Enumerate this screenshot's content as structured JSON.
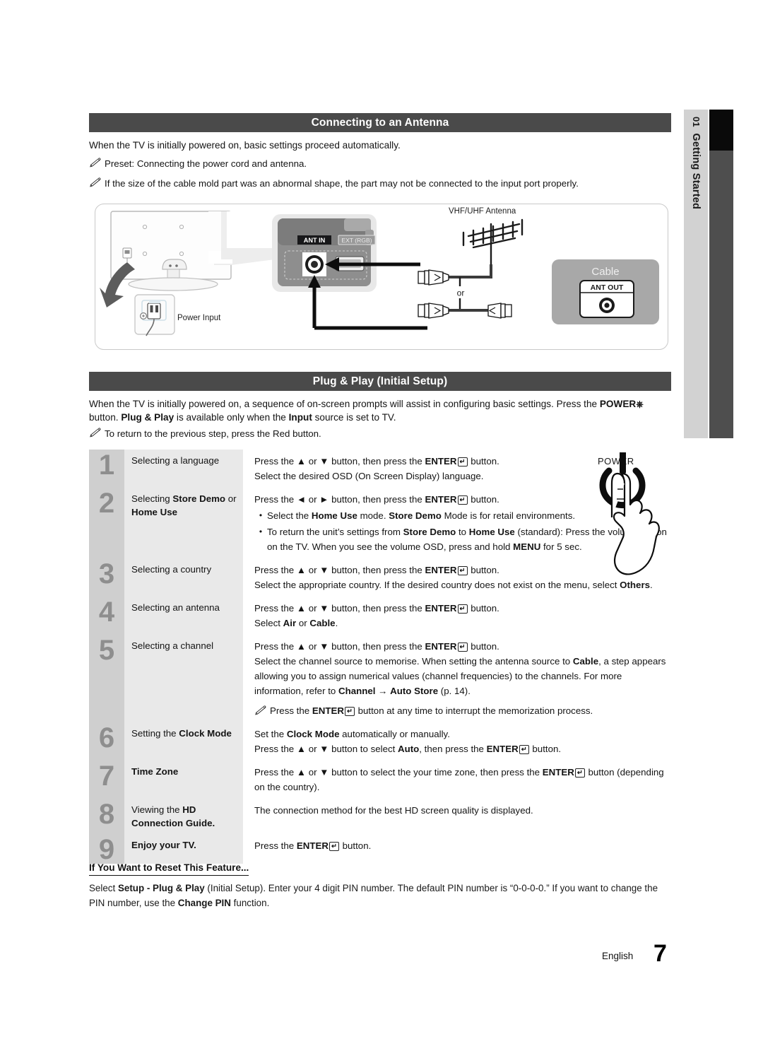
{
  "sidebar": {
    "chapter_number": "01",
    "chapter_title": "Getting Started"
  },
  "sections": {
    "antenna": {
      "title": "Connecting to an Antenna",
      "intro": "When the TV is initially powered on, basic settings proceed automatically.",
      "note1": "Preset: Connecting the power cord and antenna.",
      "note2": "If the size of the cable mold part was an abnormal shape, the part may not be connected to the input port properly."
    },
    "plugplay": {
      "title": "Plug & Play (Initial Setup)",
      "intro_1": "When the TV is initially powered on, a sequence of on-screen prompts will assist in configuring basic settings. Press the ",
      "intro_power": "POWER",
      "intro_2": " button. ",
      "intro_pp": "Plug & Play",
      "intro_3": " is available only when the ",
      "intro_input": "Input",
      "intro_4": " source is set to TV.",
      "note1": "To return to the previous step, press the Red button."
    }
  },
  "diagram": {
    "power_input_label": "Power Input",
    "ant_in_label": "ANT IN",
    "ext_rgb_label": "EXT (RGB)",
    "antenna_label": "VHF/UHF Antenna",
    "or_label": "or",
    "cable_label": "Cable",
    "ant_out_label": "ANT OUT"
  },
  "power_illustration": {
    "label": "POWER"
  },
  "steps": [
    {
      "number": "1",
      "label_parts": [
        {
          "t": "Selecting a language",
          "b": false
        }
      ],
      "lines": [
        {
          "type": "text",
          "parts": [
            {
              "t": "Press the ",
              "b": false
            },
            {
              "t": "▲",
              "b": false
            },
            {
              "t": " or ",
              "b": false
            },
            {
              "t": "▼",
              "b": false
            },
            {
              "t": " button, then press the ",
              "b": false
            },
            {
              "t": "ENTER",
              "b": true
            },
            {
              "t": "key",
              "b": false
            },
            {
              "t": " button.",
              "b": false
            }
          ]
        },
        {
          "type": "text",
          "parts": [
            {
              "t": "Select the desired OSD (On Screen Display) language.",
              "b": false
            }
          ]
        }
      ]
    },
    {
      "number": "2",
      "label_parts": [
        {
          "t": "Selecting ",
          "b": false
        },
        {
          "t": "Store Demo",
          "b": true
        },
        {
          "t": " or ",
          "b": false
        },
        {
          "t": "Home Use",
          "b": true
        }
      ],
      "lines": [
        {
          "type": "text",
          "parts": [
            {
              "t": "Press the ",
              "b": false
            },
            {
              "t": "◄",
              "b": false
            },
            {
              "t": " or ",
              "b": false
            },
            {
              "t": "►",
              "b": false
            },
            {
              "t": " button, then press the ",
              "b": false
            },
            {
              "t": "ENTER",
              "b": true
            },
            {
              "t": "key",
              "b": false
            },
            {
              "t": " button.",
              "b": false
            }
          ]
        },
        {
          "type": "bullet",
          "parts": [
            {
              "t": "Select the ",
              "b": false
            },
            {
              "t": "Home Use",
              "b": true
            },
            {
              "t": " mode. ",
              "b": false
            },
            {
              "t": "Store Demo",
              "b": true
            },
            {
              "t": " Mode is for retail environments.",
              "b": false
            }
          ]
        },
        {
          "type": "bullet",
          "parts": [
            {
              "t": "To return the unit’s settings from ",
              "b": false
            },
            {
              "t": "Store Demo",
              "b": true
            },
            {
              "t": " to ",
              "b": false
            },
            {
              "t": "Home Use",
              "b": true
            },
            {
              "t": " (standard): Press the volume button on the TV. When you see the volume OSD, press and hold ",
              "b": false
            },
            {
              "t": "MENU",
              "b": true
            },
            {
              "t": " for 5 sec.",
              "b": false
            }
          ]
        }
      ]
    },
    {
      "number": "3",
      "label_parts": [
        {
          "t": "Selecting a country",
          "b": false
        }
      ],
      "lines": [
        {
          "type": "text",
          "parts": [
            {
              "t": "Press the ",
              "b": false
            },
            {
              "t": "▲",
              "b": false
            },
            {
              "t": " or ",
              "b": false
            },
            {
              "t": "▼",
              "b": false
            },
            {
              "t": " button, then press the ",
              "b": false
            },
            {
              "t": "ENTER",
              "b": true
            },
            {
              "t": "key",
              "b": false
            },
            {
              "t": " button.",
              "b": false
            }
          ]
        },
        {
          "type": "text",
          "parts": [
            {
              "t": "Select the appropriate country. If the desired country does not exist on the menu, select ",
              "b": false
            },
            {
              "t": "Others",
              "b": true
            },
            {
              "t": ".",
              "b": false
            }
          ]
        }
      ]
    },
    {
      "number": "4",
      "label_parts": [
        {
          "t": "Selecting an antenna",
          "b": false
        }
      ],
      "lines": [
        {
          "type": "text",
          "parts": [
            {
              "t": "Press the ",
              "b": false
            },
            {
              "t": "▲",
              "b": false
            },
            {
              "t": " or ",
              "b": false
            },
            {
              "t": "▼",
              "b": false
            },
            {
              "t": " button, then press the ",
              "b": false
            },
            {
              "t": "ENTER",
              "b": true
            },
            {
              "t": "key",
              "b": false
            },
            {
              "t": " button.",
              "b": false
            }
          ]
        },
        {
          "type": "text",
          "parts": [
            {
              "t": "Select ",
              "b": false
            },
            {
              "t": "Air",
              "b": true
            },
            {
              "t": " or ",
              "b": false
            },
            {
              "t": "Cable",
              "b": true
            },
            {
              "t": ".",
              "b": false
            }
          ]
        }
      ]
    },
    {
      "number": "5",
      "label_parts": [
        {
          "t": "Selecting a channel",
          "b": false
        }
      ],
      "lines": [
        {
          "type": "text",
          "parts": [
            {
              "t": "Press the ",
              "b": false
            },
            {
              "t": "▲",
              "b": false
            },
            {
              "t": " or ",
              "b": false
            },
            {
              "t": "▼",
              "b": false
            },
            {
              "t": " button, then press the ",
              "b": false
            },
            {
              "t": "ENTER",
              "b": true
            },
            {
              "t": "key",
              "b": false
            },
            {
              "t": " button.",
              "b": false
            }
          ]
        },
        {
          "type": "text",
          "parts": [
            {
              "t": "Select the channel source to memorise. When setting the antenna source to ",
              "b": false
            },
            {
              "t": "Cable",
              "b": true
            },
            {
              "t": ", a step appears allowing you to assign numerical values (channel frequencies) to the channels. For more information, refer to ",
              "b": false
            },
            {
              "t": "Channel",
              "b": true
            },
            {
              "t": " → ",
              "b": false
            },
            {
              "t": "Auto Store",
              "b": true
            },
            {
              "t": " (p. 14).",
              "b": false
            }
          ]
        },
        {
          "type": "note",
          "parts": [
            {
              "t": "Press the ",
              "b": false
            },
            {
              "t": "ENTER",
              "b": true
            },
            {
              "t": "key",
              "b": false
            },
            {
              "t": " button at any time to interrupt the memorization process.",
              "b": false
            }
          ]
        }
      ]
    },
    {
      "number": "6",
      "label_parts": [
        {
          "t": "Setting the ",
          "b": false
        },
        {
          "t": "Clock Mode",
          "b": true
        }
      ],
      "lines": [
        {
          "type": "text",
          "parts": [
            {
              "t": "Set the ",
              "b": false
            },
            {
              "t": "Clock Mode",
              "b": true
            },
            {
              "t": " automatically or manually.",
              "b": false
            }
          ]
        },
        {
          "type": "text",
          "parts": [
            {
              "t": "Press the ",
              "b": false
            },
            {
              "t": "▲",
              "b": false
            },
            {
              "t": " or ",
              "b": false
            },
            {
              "t": "▼",
              "b": false
            },
            {
              "t": " button to select ",
              "b": false
            },
            {
              "t": "Auto",
              "b": true
            },
            {
              "t": ", then press the ",
              "b": false
            },
            {
              "t": "ENTER",
              "b": true
            },
            {
              "t": "key",
              "b": false
            },
            {
              "t": " button.",
              "b": false
            }
          ]
        }
      ]
    },
    {
      "number": "7",
      "label_parts": [
        {
          "t": "Time Zone",
          "b": true
        }
      ],
      "lines": [
        {
          "type": "text",
          "parts": [
            {
              "t": "Press the ",
              "b": false
            },
            {
              "t": "▲",
              "b": false
            },
            {
              "t": " or ",
              "b": false
            },
            {
              "t": "▼",
              "b": false
            },
            {
              "t": " button to select the your time zone, then press the ",
              "b": false
            },
            {
              "t": "ENTER",
              "b": true
            },
            {
              "t": "key",
              "b": false
            },
            {
              "t": " button (depending on the country).",
              "b": false
            }
          ]
        }
      ]
    },
    {
      "number": "8",
      "label_parts": [
        {
          "t": "Viewing the ",
          "b": false
        },
        {
          "t": "HD Connection Guide.",
          "b": true
        }
      ],
      "lines": [
        {
          "type": "text",
          "parts": [
            {
              "t": "The connection method for the best HD screen quality is displayed.",
              "b": false
            }
          ]
        }
      ]
    },
    {
      "number": "9",
      "label_parts": [
        {
          "t": "Enjoy your TV.",
          "b": true
        }
      ],
      "lines": [
        {
          "type": "text",
          "parts": [
            {
              "t": "Press the ",
              "b": false
            },
            {
              "t": "ENTER",
              "b": true
            },
            {
              "t": "key",
              "b": false
            },
            {
              "t": " button.",
              "b": false
            }
          ]
        }
      ]
    }
  ],
  "reset": {
    "title": "If You Want to Reset This Feature...",
    "body_parts": [
      {
        "t": "Select ",
        "b": false
      },
      {
        "t": "Setup - Plug & Play",
        "b": true
      },
      {
        "t": " (Initial Setup). Enter your 4 digit PIN number. The default PIN number is “0-0-0-0.” If you want to change the PIN number, use the ",
        "b": false
      },
      {
        "t": "Change PIN",
        "b": true
      },
      {
        "t": " function.",
        "b": false
      }
    ]
  },
  "footer": {
    "language": "English",
    "page_number": "7"
  },
  "colors": {
    "header_bar": "#4a4a4a",
    "step_number_bg": "#cfcfcf",
    "step_label_bg": "#e9e9e9",
    "sidetab_bg": "#d2d2d2",
    "sidebar_dark": "#4e4e4e"
  }
}
